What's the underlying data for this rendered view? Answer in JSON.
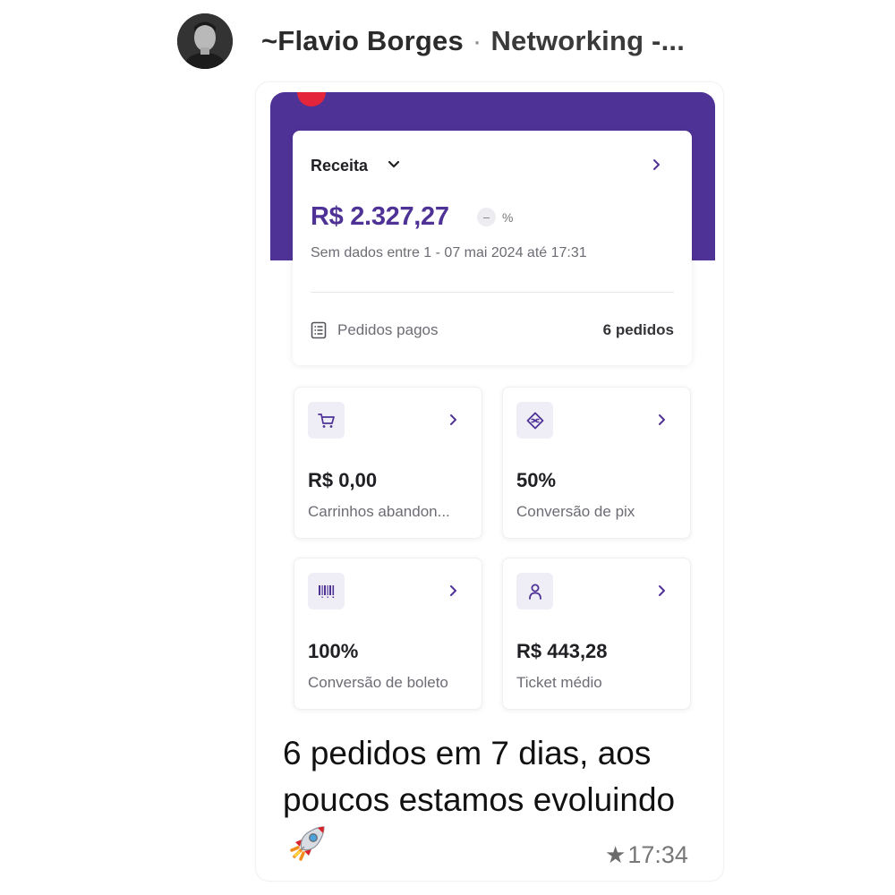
{
  "header": {
    "sender": "~Flavio Borges",
    "separator": "·",
    "group": "Networking -..."
  },
  "receita": {
    "title": "Receita",
    "value": "R$ 2.327,27",
    "pct_pill": "–",
    "pct_sign": "%",
    "subtitle": "Sem dados entre 1 - 07 mai 2024 até 17:31",
    "pedidos_label": "Pedidos pagos",
    "pedidos_value": "6 pedidos"
  },
  "cards": [
    {
      "value": "R$ 0,00",
      "label": "Carrinhos abandon...",
      "icon": "cart-icon"
    },
    {
      "value": "50%",
      "label": "Conversão de pix",
      "icon": "pix-icon"
    },
    {
      "value": "100%",
      "label": "Conversão de boleto",
      "icon": "barcode-icon"
    },
    {
      "value": "R$ 443,28",
      "label": "Ticket médio",
      "icon": "user-icon"
    }
  ],
  "message": {
    "text": "6 pedidos em 7 dias, aos poucos estamos evoluindo",
    "emoji": "rocket-icon",
    "time": "17:34",
    "starred": true
  },
  "colors": {
    "brand_purple": "#4f3296",
    "red_dot": "#e4243a",
    "icon_bg": "#efedf6"
  }
}
